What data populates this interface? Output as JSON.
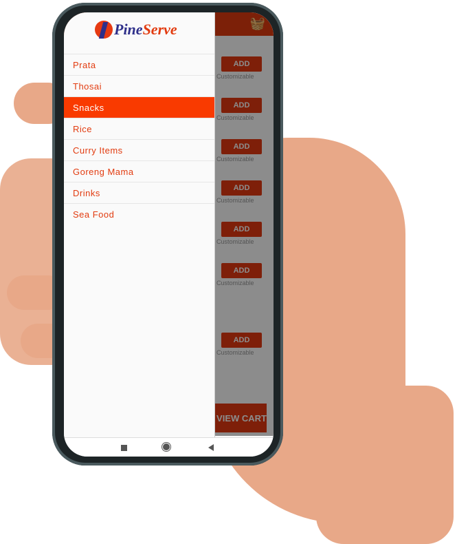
{
  "app": {
    "brand": "PineServe",
    "brand_colors": {
      "primary": "#e23b0f",
      "secondary": "#2e2f8a"
    }
  },
  "appbar": {
    "cart_icon": "basket-icon"
  },
  "drawer": {
    "items": [
      {
        "label": "Prata",
        "active": false
      },
      {
        "label": "Thosai",
        "active": false
      },
      {
        "label": "Snacks",
        "active": true
      },
      {
        "label": "Rice",
        "active": false
      },
      {
        "label": "Curry Items",
        "active": false
      },
      {
        "label": "Goreng Mama",
        "active": false
      },
      {
        "label": "Drinks",
        "active": false
      },
      {
        "label": "Sea Food",
        "active": false
      }
    ]
  },
  "menu": {
    "add_label": "ADD",
    "customizable_label": "Customizable",
    "view_cart_label": "VIEW CART"
  },
  "navbar": {
    "buttons": [
      "recents-icon",
      "home-icon",
      "back-icon"
    ]
  }
}
